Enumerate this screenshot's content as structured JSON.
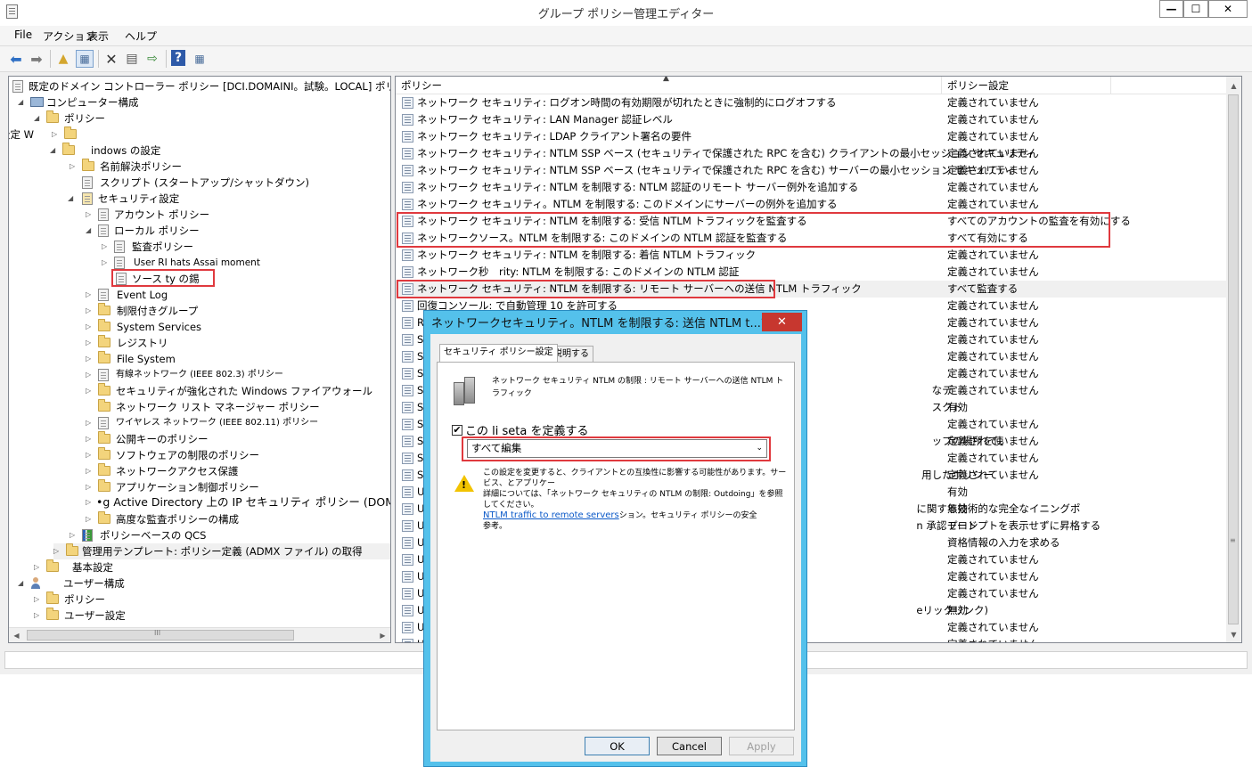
{
  "window": {
    "title": "グループ ポリシー管理エディター",
    "controls": {
      "minimize": "—",
      "maximize": "☐",
      "close": "✕"
    }
  },
  "menu": [
    "File",
    "アクション",
    "表示",
    "ヘルプ"
  ],
  "tree": {
    "nodes": [
      "既定のドメイン コントローラー ポリシー [DCI.DOMAINI。試験。LOCAL] ポリシー",
      "コンピューター構成",
      "ポリシー",
      "設定 W",
      "indows の設定",
      "名前解決ポリシー",
      "スクリプト (スタートアップ/シャットダウン)",
      "セキュリティ設定",
      "アカウント ポリシー",
      "ローカル ポリシー",
      "監査ポリシー",
      "User RI hats Assai moment",
      "ソース ty の錫",
      "Event Log",
      "制限付きグループ",
      "System Services",
      "レジストリ",
      "File System",
      "有線ネットワーク (IEEE 802.3) ポリシー",
      "セキュリティが強化された Windows ファイアウォール",
      "ネットワーク リスト マネージャー ポリシー",
      "ワイヤレス ネットワーク (IEEE 802.11) ポリシー",
      "公開キーのポリシー",
      "ソフトウェアの制限のポリシー",
      "ネットワークアクセス保護",
      "アプリケーション制御ポリシー",
      "•g Active Directory 上の IP セキュリティ ポリシー (DOMAINI 試験。LC",
      "高度な監査ポリシーの構成",
      "ポリシーベースの QCS",
      "管理用テンプレート: ポリシー定義 (ADMX ファイル) の取得",
      "基本設定",
      "ユーザー構成",
      "ポリシー",
      "ユーザー設定"
    ],
    "scroll_indicator": "III"
  },
  "list": {
    "columns": {
      "policy": "ポリシー",
      "setting": "ポリシー設定"
    },
    "rows": [
      {
        "name": "ネットワーク セキュリティ: ログオン時間の有効期限が切れたときに強制的にログオフする",
        "setting": "定義されていません"
      },
      {
        "name": "ネットワーク セキュリティ: LAN Manager 認証レベル",
        "setting": "定義されていません"
      },
      {
        "name": "ネットワーク セキュリティ: LDAP クライアント署名の要件",
        "setting": "定義されていません"
      },
      {
        "name": "ネットワーク セキュリティ: NTLM SSP ベース (セキュリティで保護された RPC を含む) クライアントの最小セッション セキュリティ",
        "setting": "定義されていません"
      },
      {
        "name": "ネットワーク セキュリティ: NTLM SSP ベース (セキュリティで保護された RPC を含む) サーバーの最小セッション セキュリティ",
        "setting": "定義されていません"
      },
      {
        "name": "ネットワーク セキュリティ: NTLM を制限する: NTLM 認証のリモート サーバー例外を追加する",
        "setting": "定義されていません"
      },
      {
        "name": "ネットワーク セキュリティ。NTLM を制限する: このドメインにサーバーの例外を追加する",
        "setting": "定義されていません"
      },
      {
        "name": "ネットワーク セキュリティ: NTLM を制限する: 受信 NTLM トラフィックを監査する",
        "setting": "すべてのアカウントの監査を有効にする"
      },
      {
        "name": "ネットワークソース。NTLM を制限する: このドメインの NTLM 認証を監査する",
        "setting": "すべて有効にする"
      },
      {
        "name": "ネットワーク セキュリティ: NTLM を制限する: 着信 NTLM トラフィック",
        "setting": "定義されていません"
      },
      {
        "name": "ネットワーク秒　rity: NTLM を制限する: このドメインの NTLM 認証",
        "setting": "定義されていません"
      },
      {
        "name": "ネットワーク セキュリティ: NTLM を制限する: リモート サーバーへの送信 NTLM トラフィック",
        "setting": "すべて監査する"
      },
      {
        "name": "回復コンソール: で自動管理 10 を許可する",
        "setting": "定義されていません"
      },
      {
        "name": "R",
        "setting": "定義されていません"
      },
      {
        "name": "S",
        "setting": "定義されていません"
      },
      {
        "name": "S",
        "setting": "定義されていません"
      },
      {
        "name": "S",
        "setting": "定義されていません"
      },
      {
        "name": "Sy　　　　　　　　　　　　　　　　　　　　　　　　　　　　　　　　　　　　　　　　　　　　　　　　　なデ",
        "setting": "定義されていません"
      },
      {
        "name": "Sy　　　　　　　　　　　　　　　　　　　　　　　　　　　　　　　　　　　　　　　　　　　　　　　　　スクト",
        "setting": "有効"
      },
      {
        "name": "Sy",
        "setting": "定義されていません"
      },
      {
        "name": "Sy　　　　　　　　　　　　　　　　　　　　　　　　　　　　　　　　　　　　　　　　　　　　　　　　　ップの場所を使",
        "setting": "定義されていません"
      },
      {
        "name": "Sy",
        "setting": "定義されていません"
      },
      {
        "name": "Sy　　　　　　　　　　　　　　　　　　　　　　　　　　　　　　　　　　　　　　　　　　　　　　　　用したポリシー",
        "setting": "定義されていません"
      },
      {
        "name": "U",
        "setting": "有効"
      },
      {
        "name": "U　　　　　　　　　　　　　　　　　　　　　　　　　　　　　　　　　　　　　　　　　　　　　　　　に関する技術的な完全なイニングポ",
        "setting": "無効"
      },
      {
        "name": "U　　　　　　　　　　　　　　　　　　　　　　　　　　　　　　　　　　　　　　　　　　　　　　　　n 承認モード",
        "setting": "プロンプトを表示せずに昇格する"
      },
      {
        "name": "U",
        "setting": "資格情報の入力を求める"
      },
      {
        "name": "U",
        "setting": "定義されていません"
      },
      {
        "name": "U",
        "setting": "定義されていません"
      },
      {
        "name": "U",
        "setting": "定義されていません"
      },
      {
        "name": "U　　　　　　　　　　　　　　　　　　　　　　　　　　　　　　　　　　　　　　　　　　　　　　　　eリックリンク)",
        "setting": "無効"
      },
      {
        "name": "U",
        "setting": "定義されていません"
      },
      {
        "name": "U",
        "setting": "定義されていません"
      }
    ]
  },
  "dialog": {
    "title": "ネットワークセキュリティ。NTLM を制限する: 送信 NTLM t...?",
    "close": "✕",
    "tabs": [
      "セキュリティ ポリシー設定",
      "説明する"
    ],
    "description": "ネットワーク セキュリティ NTLM の制限 : リモート サーバーへの送信 NTLM トラフィック",
    "checkbox_label": "この li seta を定義する",
    "checkbox_mark": "✔",
    "select_value": "すべて編集",
    "select_arrow": "⌄",
    "warning_mark": "!",
    "warning_line1": "この設定を変更すると、クライアントとの互換性に影響する可能性があります。サービス、とアプリケー",
    "warning_line2": "詳細については、「ネットワーク セキュリティの NTLM の制限: Outdoing」を参照してください。",
    "warning_link": "NTLM traffic to remote servers",
    "warning_line3": "ション。セキュリティ ポリシーの安全",
    "warning_line4": "参考。",
    "buttons": {
      "ok": "OK",
      "cancel": "Cancel",
      "apply": "Apply"
    }
  },
  "toolbar_icons": [
    "back-icon",
    "forward-icon",
    "up-folder-icon",
    "show-tree-icon",
    "delete-icon",
    "properties-icon",
    "export-icon",
    "help-icon",
    "view-icon"
  ],
  "colors": {
    "highlight_box": "#e0393e",
    "dialog_frame": "#54c1eb",
    "close_button": "#c7372f"
  }
}
